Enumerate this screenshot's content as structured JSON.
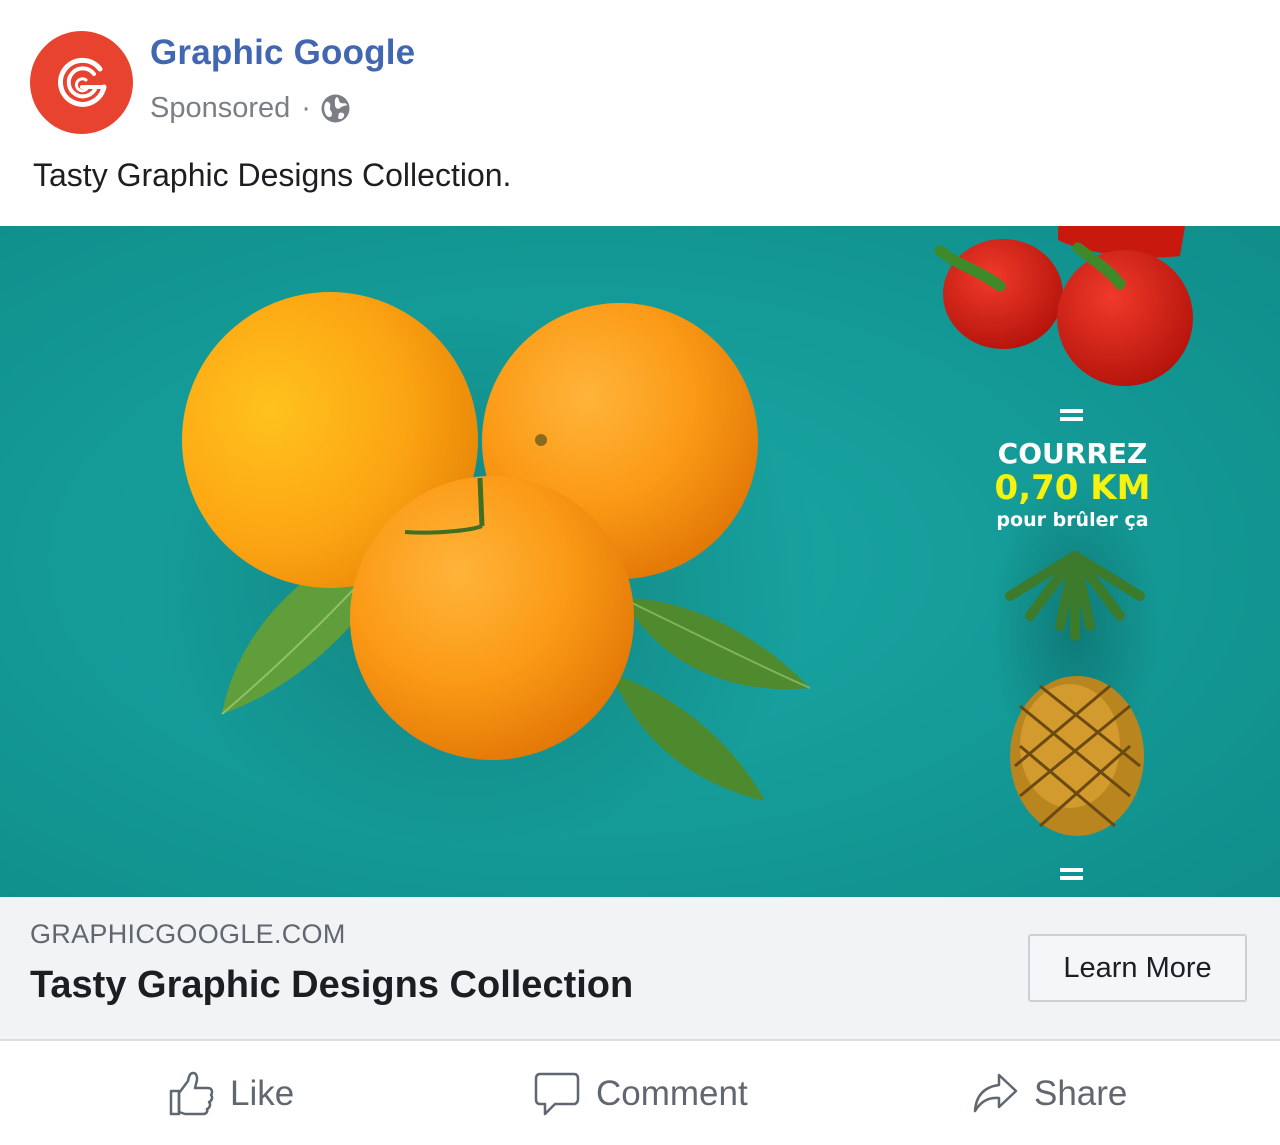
{
  "post": {
    "page_name": "Graphic Google",
    "sponsored_label": "Sponsored",
    "separator": "·",
    "privacy_icon": "globe-icon",
    "text": "Tasty Graphic Designs Collection."
  },
  "ad_image": {
    "line1": "COURREZ",
    "line2": "0,70 KM",
    "line3": "pour brûler ça",
    "colors": {
      "background": "#149b98",
      "highlight": "#f4f20e"
    }
  },
  "link": {
    "domain": "GRAPHICGOOGLE.COM",
    "headline": "Tasty Graphic Designs Collection",
    "cta_label": "Learn More"
  },
  "actions": [
    {
      "label": "Like",
      "icon": "thumbs-up-icon"
    },
    {
      "label": "Comment",
      "icon": "comment-icon"
    },
    {
      "label": "Share",
      "icon": "share-icon"
    }
  ],
  "colors": {
    "brand": "#4267b2",
    "avatar": "#e8432f",
    "muted": "#606770"
  }
}
